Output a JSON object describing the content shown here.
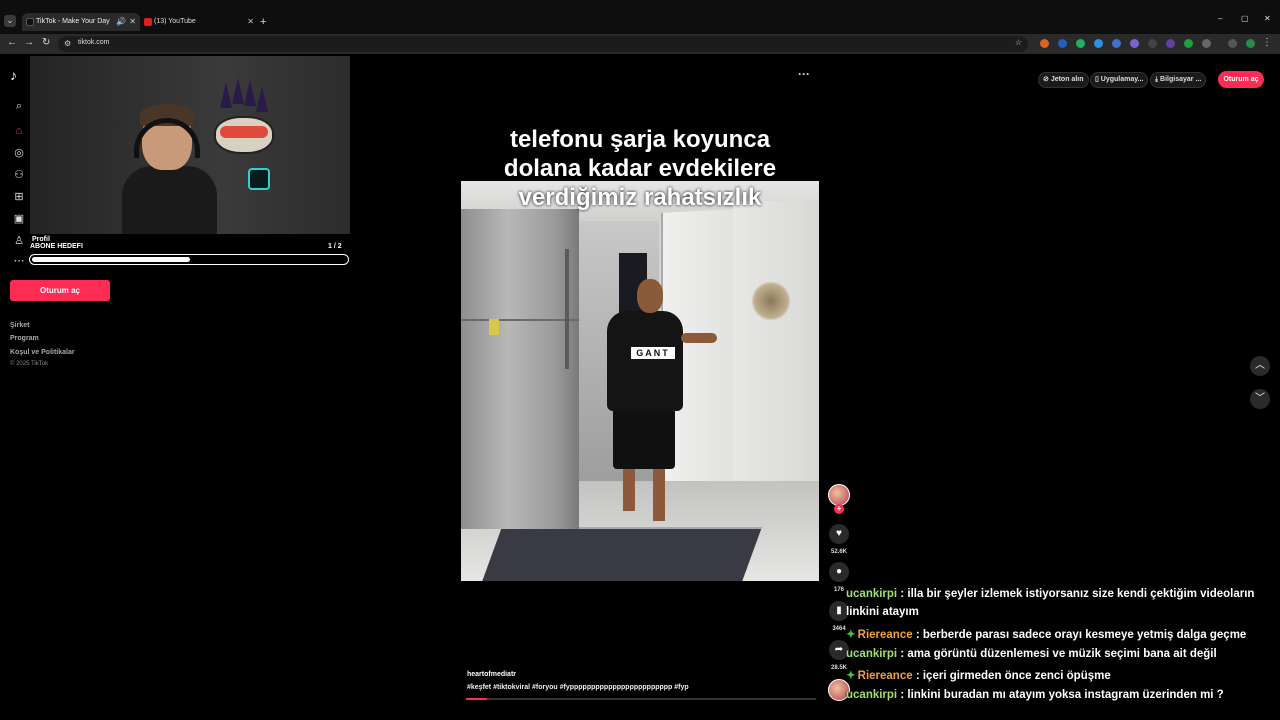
{
  "browser": {
    "tabs": [
      {
        "title": "TikTok - Make Your Day",
        "active": true
      },
      {
        "title": "(13) YouTube",
        "active": false
      }
    ],
    "url": "tiktok.com",
    "new_tab": "+",
    "controls": {
      "minimize": "–",
      "maximize": "▢",
      "close": "✕"
    }
  },
  "sidebar": {
    "logo": "♪",
    "login_button": "Oturum aç",
    "footer": [
      "Şirket",
      "Program",
      "Koşul ve Politikalar"
    ],
    "copyright": "© 2025 TikTok"
  },
  "stream_overlay": {
    "profile_label": "Profil",
    "goal_title": "ABONE HEDEFI",
    "goal_count": "1 / 2",
    "goal_progress": 0.5
  },
  "video": {
    "caption": [
      "telefonu şarja koyunca",
      "dolana kadar evdekilere",
      "verdiğimiz rahatsızlık"
    ],
    "shirt_text": "GANT",
    "author": "heartofmediatr",
    "hashtags": "#keşfet #tiktokviral #foryou #fypppppppppppppppppppppppp #fyp",
    "progress": 0.06,
    "more": "···"
  },
  "actions": {
    "likes": "52.6K",
    "comments": "176",
    "saves": "3464",
    "shares": "28.5K"
  },
  "header": {
    "coins": "Jeton alın",
    "app": "Uygulamay...",
    "desktop": "Bilgisayar ...",
    "login": "Oturum aç"
  },
  "chat": [
    {
      "user": "ucankirpi",
      "text": ": illa bir şeyler izlemek istiyorsanız size kendi çektiğim videoların",
      "cont": "linkini atayım",
      "color": "#9fe070",
      "badge": false
    },
    {
      "user": "Riereance",
      "text": ": berberde parası sadece orayı kesmeye yetmiş dalga geçme",
      "color": "#f0a040",
      "badge": true
    },
    {
      "user": "ucankirpi",
      "text": ": ama görüntü düzenlemesi ve müzik seçimi bana ait değil",
      "color": "#9fe070",
      "badge": false
    },
    {
      "user": "Riereance",
      "text": ": içeri girmeden önce zenci öpüşme",
      "color": "#f0a040",
      "badge": true
    },
    {
      "user": "ucankirpi",
      "text": ": linkini buradan mı atayım yoksa instagram üzerinden mi ?",
      "color": "#9fe070",
      "badge": false
    }
  ]
}
